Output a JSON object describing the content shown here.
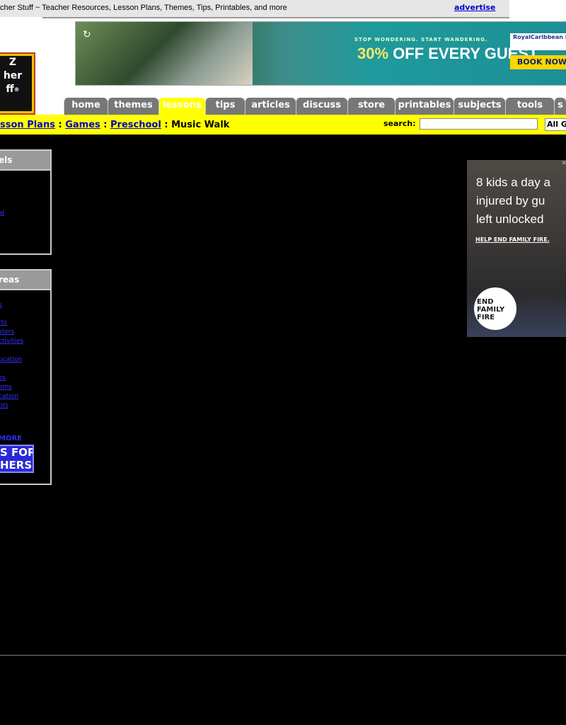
{
  "header": {
    "tagline": "cher Stuff ~ Teacher Resources, Lesson Plans, Themes, Tips, Printables, and more",
    "advertise_label": "advertise"
  },
  "logo": {
    "lines": [
      "Z",
      "her",
      "ff"
    ],
    "reg": "®"
  },
  "banner_ad": {
    "replay_icon": "replay-icon",
    "tagline": "STOP WONDERING. START WANDERING.",
    "offer_pct": "30%",
    "offer_rest": " OFF EVERY GUEST",
    "brand": "RoyalCaribbean INTERNATIONAL",
    "cta": "BOOK NOW"
  },
  "nav": {
    "tabs": [
      {
        "label": "home"
      },
      {
        "label": "themes"
      },
      {
        "label": "lessons"
      },
      {
        "label": "tips"
      },
      {
        "label": "articles"
      },
      {
        "label": "discuss"
      },
      {
        "label": "store"
      },
      {
        "label": "printables"
      },
      {
        "label": "subjects"
      },
      {
        "label": "tools"
      },
      {
        "label": "s"
      }
    ],
    "active": "lessons"
  },
  "breadcrumb": {
    "items": [
      "sson Plans",
      "Games",
      "Preschool"
    ],
    "separator": " : ",
    "current": "Music Walk"
  },
  "search": {
    "label": "search:",
    "value": "",
    "select_value": "All G"
  },
  "sidebar": {
    "levels": {
      "title": "els",
      "link": "al"
    },
    "areas": {
      "title": "reas",
      "links": [
        "s",
        "rts",
        "sters",
        "ctivities",
        "ucation",
        "es",
        "ems",
        "cation",
        "nts"
      ],
      "more": "MORE",
      "badge": [
        "S FOR",
        "HERS"
      ]
    }
  },
  "side_ad": {
    "lines": [
      "8 kids a day a",
      "injured by gu",
      "left unlocked"
    ],
    "help": "HELP END FAMILY FIRE.",
    "logo_lines": [
      "END",
      "FAMILY",
      "FIRE"
    ],
    "close_icon": "close-icon"
  },
  "colors": {
    "nav_tab": "#777777",
    "active_tab": "#ffff00",
    "crumb_bar": "#ffff00",
    "link": "#0000cc",
    "content_bg": "#000000"
  }
}
